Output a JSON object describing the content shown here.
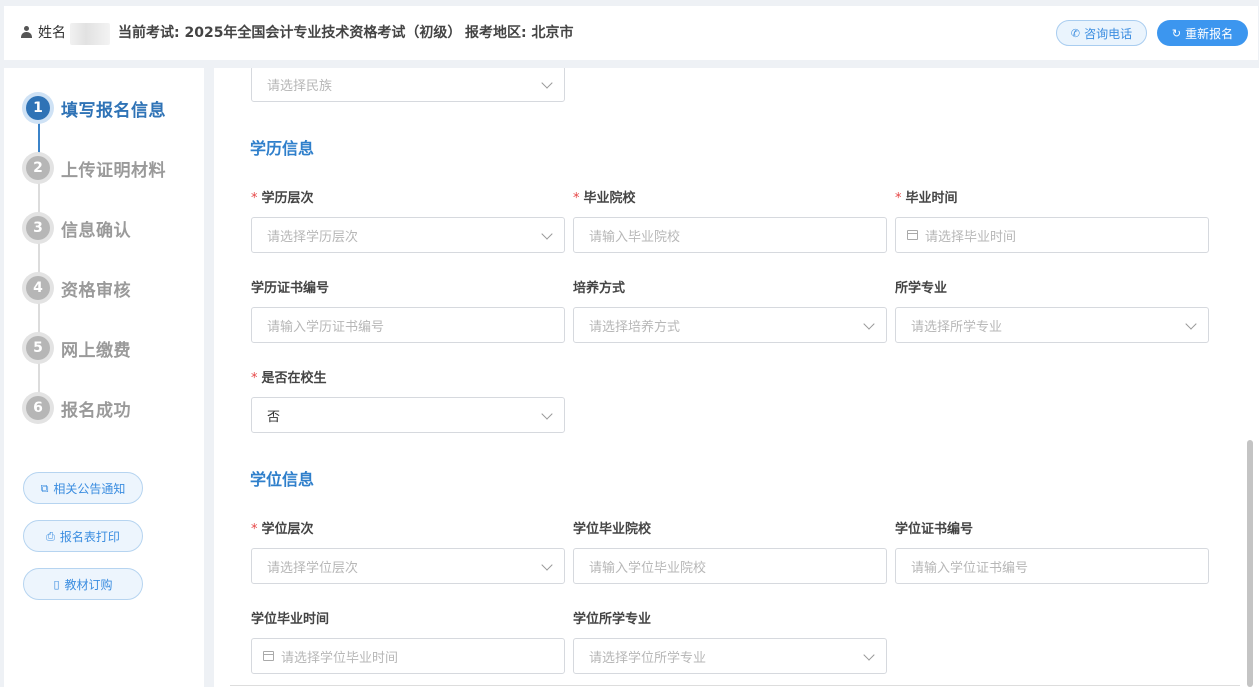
{
  "header": {
    "name_label": "姓名",
    "exam_label": "当前考试: 2025年全国会计专业技术资格考试（初级）",
    "region_label": "报考地区: 北京市",
    "consult_button": "咨询电话",
    "reapply_button": "重新报名",
    "accent_color": "#3c96ef"
  },
  "sidebar": {
    "steps": [
      {
        "num": "1",
        "label": "填写报名信息",
        "active": true
      },
      {
        "num": "2",
        "label": "上传证明材料",
        "active": false
      },
      {
        "num": "3",
        "label": "信息确认",
        "active": false
      },
      {
        "num": "4",
        "label": "资格审核",
        "active": false
      },
      {
        "num": "5",
        "label": "网上缴费",
        "active": false
      },
      {
        "num": "6",
        "label": "报名成功",
        "active": false
      }
    ],
    "buttons": [
      {
        "label": "相关公告通知",
        "icon": "copy-icon"
      },
      {
        "label": "报名表打印",
        "icon": "printer-icon"
      },
      {
        "label": "教材订购",
        "icon": "book-icon"
      }
    ]
  },
  "form": {
    "ethnicity_placeholder": "请选择民族",
    "education_section": {
      "title": "学历信息",
      "education_level": {
        "label": "学历层次",
        "required": true,
        "placeholder": "请选择学历层次"
      },
      "graduate_school": {
        "label": "毕业院校",
        "required": true,
        "placeholder": "请输入毕业院校"
      },
      "graduation_time": {
        "label": "毕业时间",
        "required": true,
        "placeholder": "请选择毕业时间"
      },
      "certificate_no": {
        "label": "学历证书编号",
        "required": false,
        "placeholder": "请输入学历证书编号"
      },
      "training_mode": {
        "label": "培养方式",
        "required": false,
        "placeholder": "请选择培养方式"
      },
      "major": {
        "label": "所学专业",
        "required": false,
        "placeholder": "请选择所学专业"
      },
      "in_school": {
        "label": "是否在校生",
        "required": true,
        "value": "否"
      }
    },
    "degree_section": {
      "title": "学位信息",
      "degree_level": {
        "label": "学位层次",
        "required": true,
        "placeholder": "请选择学位层次"
      },
      "degree_school": {
        "label": "学位毕业院校",
        "required": false,
        "placeholder": "请输入学位毕业院校"
      },
      "degree_certificate": {
        "label": "学位证书编号",
        "required": false,
        "placeholder": "请输入学位证书编号"
      },
      "degree_time": {
        "label": "学位毕业时间",
        "required": false,
        "placeholder": "请选择学位毕业时间"
      },
      "degree_major": {
        "label": "学位所学专业",
        "required": false,
        "placeholder": "请选择学位所学专业"
      }
    },
    "required_mark": "*"
  }
}
